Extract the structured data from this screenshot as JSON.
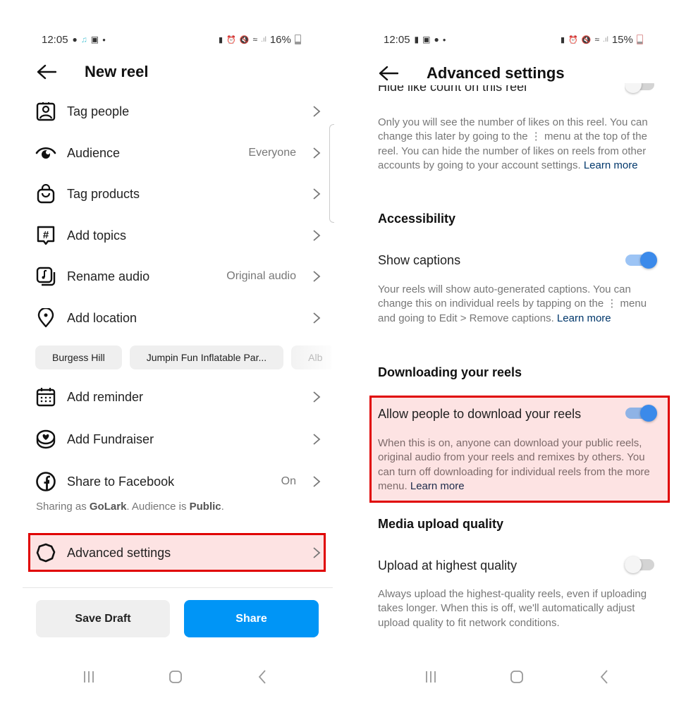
{
  "left": {
    "status_bar": {
      "time": "12:05",
      "notification_icons": [
        "chat-bubble-icon",
        "tiktok-icon",
        "gallery-icon",
        "dot-icon"
      ],
      "system_icons": [
        "battery-saver-icon",
        "alarm-icon",
        "mute-icon",
        "wifi-icon",
        "signal-icon"
      ],
      "battery": "16%"
    },
    "header": {
      "title": "New reel"
    },
    "items": [
      {
        "icon": "tag-people-icon",
        "label": "Tag people",
        "value": ""
      },
      {
        "icon": "audience-eye-icon",
        "label": "Audience",
        "value": "Everyone"
      },
      {
        "icon": "shopping-bag-icon",
        "label": "Tag products",
        "value": ""
      },
      {
        "icon": "hashtag-icon",
        "label": "Add topics",
        "value": ""
      },
      {
        "icon": "audio-icon",
        "label": "Rename audio",
        "value": "Original audio"
      },
      {
        "icon": "location-pin-icon",
        "label": "Add location",
        "value": ""
      }
    ],
    "location_chips": [
      "Burgess Hill",
      "Jumpin Fun Inflatable Par...",
      "Alb"
    ],
    "items2": [
      {
        "icon": "calendar-icon",
        "label": "Add reminder",
        "value": ""
      },
      {
        "icon": "fundraiser-heart-icon",
        "label": "Add Fundraiser",
        "value": ""
      },
      {
        "icon": "facebook-icon",
        "label": "Share to Facebook",
        "value": "On"
      }
    ],
    "sharing_note": {
      "prefix": "Sharing as ",
      "account": "GoLark",
      "middle": ". Audience is ",
      "audience": "Public",
      "suffix": "."
    },
    "advanced": {
      "icon": "gear-icon",
      "label": "Advanced settings"
    },
    "buttons": {
      "save_draft": "Save Draft",
      "share": "Share"
    },
    "colors": {
      "share_button": "#0095f6",
      "highlight_border": "#e00000",
      "highlight_fill": "#fde3e3"
    }
  },
  "right": {
    "status_bar": {
      "time": "12:05",
      "notification_icons": [
        "alert-icon",
        "gallery-icon",
        "chat-bubble-icon",
        "dot-icon"
      ],
      "system_icons": [
        "battery-saver-icon",
        "alarm-icon",
        "mute-icon",
        "wifi-icon",
        "signal-icon"
      ],
      "battery": "15%"
    },
    "header": {
      "title": "Advanced settings"
    },
    "hide_like_count": {
      "label": "Hide like count on this reel",
      "enabled": false,
      "description": "Only you will see the number of likes on this reel. You can change this later by going to the ⋮ menu at the top of the reel. You can hide the number of likes on reels from other accounts by going to your account settings. ",
      "link": "Learn more"
    },
    "accessibility": {
      "heading": "Accessibility",
      "show_captions": {
        "label": "Show captions",
        "enabled": true,
        "description": "Your reels will show auto-generated captions. You can change this on individual reels by tapping on the ⋮ menu and going to Edit > Remove captions. ",
        "link": "Learn more"
      }
    },
    "downloading": {
      "heading": "Downloading your reels",
      "allow_download": {
        "label": "Allow people to download your reels",
        "enabled": true,
        "description": "When this is on, anyone can download your public reels, original audio from your reels and remixes by others. You can turn off downloading for individual reels from the more menu. ",
        "link": "Learn more"
      }
    },
    "media_quality": {
      "heading": "Media upload quality",
      "upload_highest": {
        "label": "Upload at highest quality",
        "enabled": false,
        "description": "Always upload the highest-quality reels, even if uploading takes longer. When this is off, we'll automatically adjust upload quality to fit network conditions."
      }
    },
    "colors": {
      "toggle_on": "#3b8aea",
      "link": "#00376b"
    }
  },
  "navbar": {
    "buttons": [
      "recent-apps-icon",
      "home-icon",
      "back-icon"
    ]
  }
}
